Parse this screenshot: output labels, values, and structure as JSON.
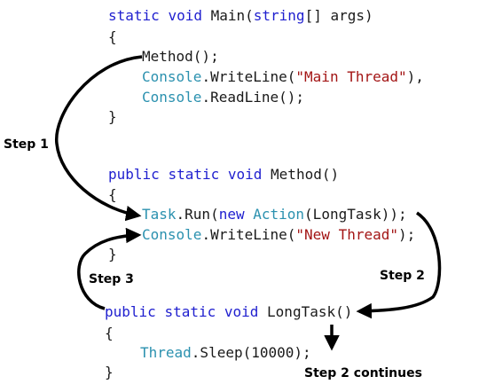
{
  "code": {
    "main_sig": {
      "kw1": "static",
      "kw2": "void",
      "name": " Main(",
      "type": "string",
      "rest": "[] args)"
    },
    "main_open": "{",
    "main_l1": "Method();",
    "main_l2": {
      "type": "Console",
      "mid": ".WriteLine(",
      "str": "\"Main Thread\"",
      "end": "),"
    },
    "main_l3": {
      "type": "Console",
      "rest": ".ReadLine();"
    },
    "main_close": "}",
    "method_sig": {
      "kw1": "public",
      "kw2": "static",
      "kw3": "void",
      "name": " Method()"
    },
    "method_open": "{",
    "method_l1": {
      "type1": "Task",
      "mid1": ".Run(",
      "kw": "new",
      "sp": " ",
      "type2": "Action",
      "end": "(LongTask));"
    },
    "method_l2": {
      "type": "Console",
      "mid": ".WriteLine(",
      "str": "\"New Thread\"",
      "end": ");"
    },
    "method_close": "}",
    "long_sig": {
      "kw1": "public",
      "kw2": "static",
      "kw3": "void",
      "name": " LongTask()"
    },
    "long_open": "{",
    "long_l1": {
      "type": "Thread",
      "rest": ".Sleep(10000);"
    },
    "long_close": "}"
  },
  "labels": {
    "step1": "Step 1",
    "step2": "Step 2",
    "step3": "Step 3",
    "step2_continues": "Step 2 continues"
  },
  "colors": {
    "keyword": "#1f1fcf",
    "type": "#2b91af",
    "string": "#a31515",
    "arrow": "#000000"
  }
}
